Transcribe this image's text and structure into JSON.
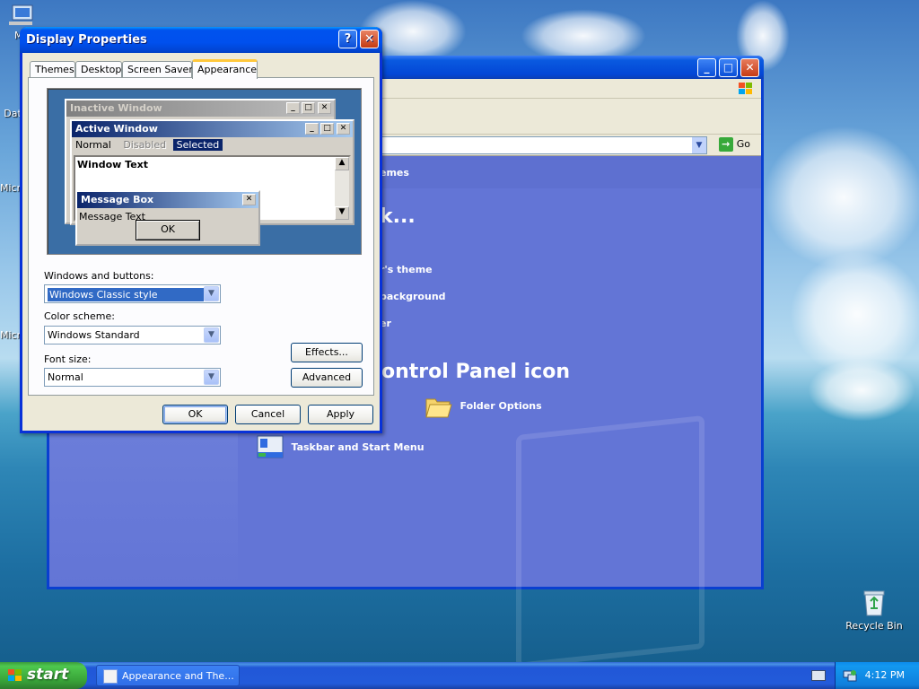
{
  "desktop": {
    "icons": [
      {
        "label": "My",
        "name": "my-computer-icon"
      },
      {
        "label": "Dat",
        "name": "data-icon"
      },
      {
        "label": "Micro",
        "name": "microsoft-icon-1"
      },
      {
        "label": "Micro",
        "name": "microsoft-icon-2"
      },
      {
        "label": "Recycle Bin",
        "name": "recycle-bin-icon"
      }
    ]
  },
  "control_panel": {
    "address_go": "Go",
    "banner_fragment": "emes",
    "pick_fragment": "k...",
    "tasks": [
      "r's theme",
      "background",
      "er"
    ],
    "icon_heading": "ontrol Panel icon",
    "icons": [
      "Folder Options",
      "Taskbar and Start Menu"
    ]
  },
  "dialog": {
    "title": "Display Properties",
    "tabs": [
      "Themes",
      "Desktop",
      "Screen Saver",
      "Appearance"
    ],
    "active_tab": "Appearance",
    "preview": {
      "inactive_window": "Inactive Window",
      "active_window": "Active Window",
      "menu_normal": "Normal",
      "menu_disabled": "Disabled",
      "menu_selected": "Selected",
      "window_text": "Window Text",
      "message_box": "Message Box",
      "message_text": "Message Text",
      "ok": "OK"
    },
    "windows_buttons_label": "Windows and buttons:",
    "windows_buttons_value": "Windows Classic style",
    "color_scheme_label": "Color scheme:",
    "color_scheme_value": "Windows Standard",
    "font_size_label": "Font size:",
    "font_size_value": "Normal",
    "effects_button": "Effects...",
    "advanced_button": "Advanced",
    "ok_button": "OK",
    "cancel_button": "Cancel",
    "apply_button": "Apply"
  },
  "taskbar": {
    "start_label": "start",
    "task_label": "Appearance and The...",
    "clock": "4:12 PM"
  }
}
